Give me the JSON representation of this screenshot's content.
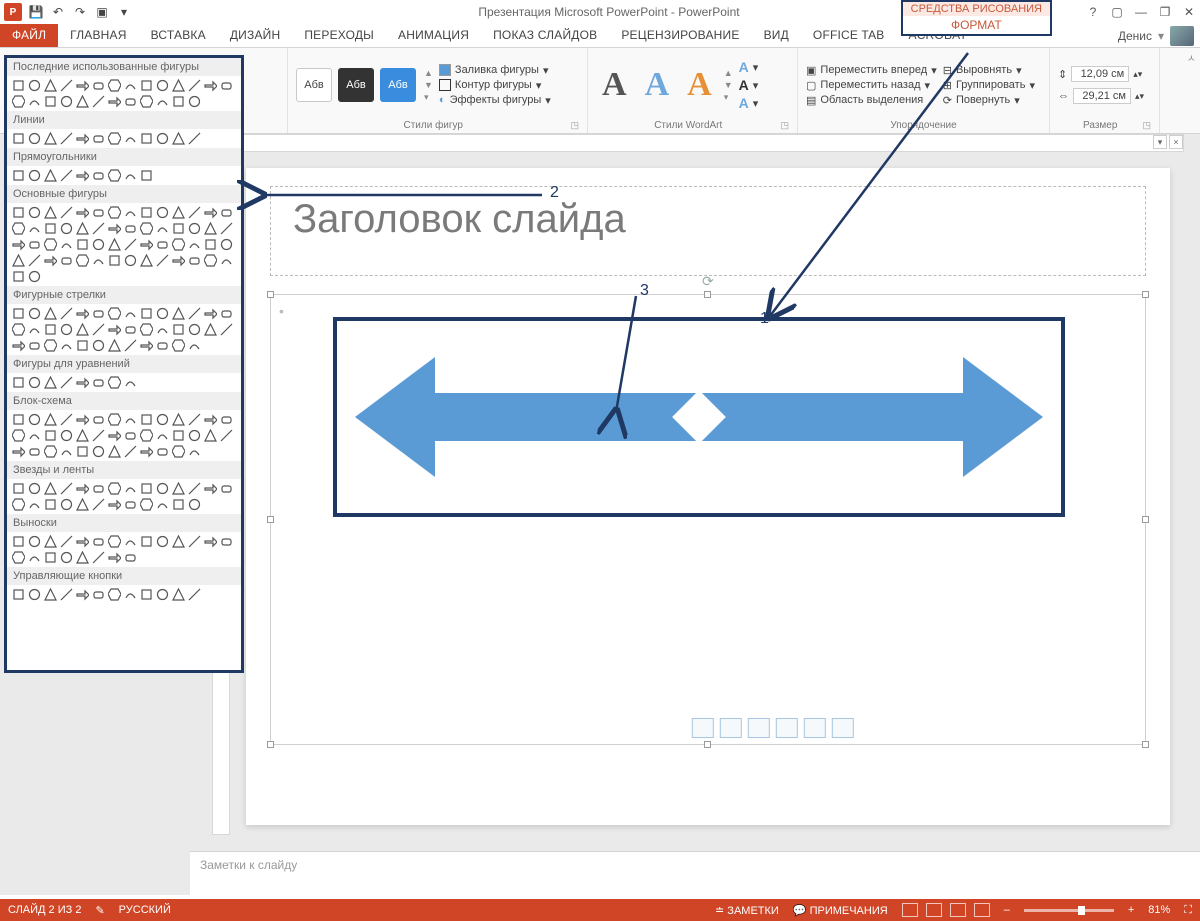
{
  "title": "Презентация Microsoft PowerPoint - PowerPoint",
  "user": "Денис",
  "contextual_tab": {
    "group": "СРЕДСТВА РИСОВАНИЯ",
    "tab": "ФОРМАТ"
  },
  "tabs": [
    "ФАЙЛ",
    "ГЛАВНАЯ",
    "ВСТАВКА",
    "ДИЗАЙН",
    "ПЕРЕХОДЫ",
    "АНИМАЦИЯ",
    "ПОКАЗ СЛАЙДОВ",
    "РЕЦЕНЗИРОВАНИЕ",
    "ВИД",
    "OFFICE TAB",
    "ACROBAT"
  ],
  "ribbon": {
    "shape_styles": {
      "sample": "Абв",
      "fill": "Заливка фигуры",
      "outline": "Контур фигуры",
      "effects": "Эффекты фигуры",
      "label": "Стили фигур"
    },
    "wordart": {
      "label": "Стили WordArt"
    },
    "arrange": {
      "bring_forward": "Переместить вперед",
      "send_backward": "Переместить назад",
      "selection_pane": "Область выделения",
      "align": "Выровнять",
      "group": "Группировать",
      "rotate": "Повернуть",
      "label": "Упорядочение"
    },
    "size": {
      "height": "12,09 см",
      "width": "29,21 см",
      "label": "Размер"
    }
  },
  "shapes_panel": {
    "recent": "Последние использованные фигуры",
    "lines": "Линии",
    "rectangles": "Прямоугольники",
    "basic": "Основные фигуры",
    "block_arrows": "Фигурные стрелки",
    "equation": "Фигуры для уравнений",
    "flowchart": "Блок-схема",
    "stars": "Звезды и ленты",
    "callouts": "Выноски",
    "action": "Управляющие кнопки"
  },
  "slide": {
    "title_placeholder": "Заголовок слайда",
    "notes_placeholder": "Заметки к слайду"
  },
  "annotations": {
    "n1": "1",
    "n2": "2",
    "n3": "3"
  },
  "statusbar": {
    "slide_of": "СЛАЙД 2 ИЗ 2",
    "lang": "РУССКИЙ",
    "notes": "ЗАМЕТКИ",
    "comments": "ПРИМЕЧАНИЯ",
    "zoom": "81%"
  }
}
